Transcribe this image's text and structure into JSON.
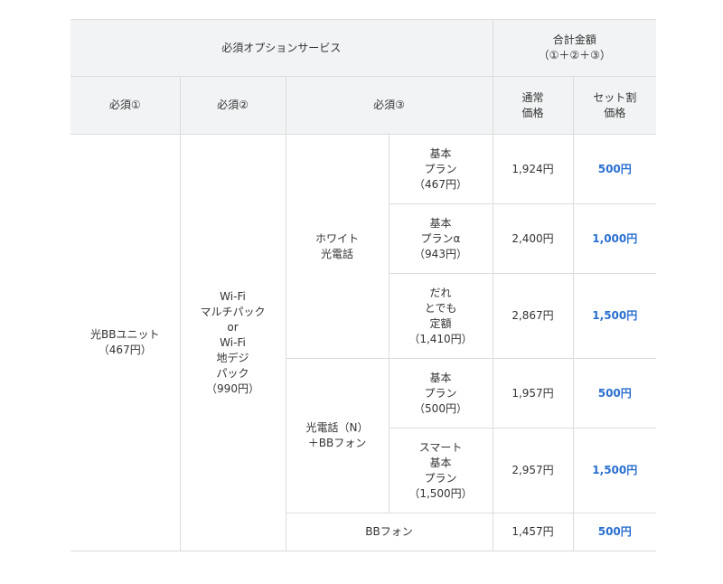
{
  "header": {
    "options_group": "必須オプションサービス",
    "total_group_line1": "合計金額",
    "total_group_line2": "（①＋②＋③）",
    "req1": "必須①",
    "req2": "必須②",
    "req3": "必須③",
    "regular_line1": "通常",
    "regular_line2": "価格",
    "set_line1": "セット割",
    "set_line2": "価格"
  },
  "unit": {
    "name": "光BBユニット",
    "price": "（467円）"
  },
  "wifi": {
    "line1": "Wi-Fi",
    "line2": "マルチパック",
    "line3": "or",
    "line4": "Wi-Fi",
    "line5": "地デジ",
    "line6": "パック",
    "line7": "（990円）"
  },
  "groups": {
    "white": {
      "line1": "ホワイト",
      "line2": "光電話"
    },
    "hikari_n": {
      "line1": "光電話（N）",
      "line2": "＋BBフォン"
    },
    "bbphone": "BBフォン"
  },
  "rows": [
    {
      "plan": [
        "基本",
        "プラン",
        "（467円）"
      ],
      "regular": "1,924円",
      "set": "500円"
    },
    {
      "plan": [
        "基本",
        "プランα",
        "（943円）"
      ],
      "regular": "2,400円",
      "set": "1,000円"
    },
    {
      "plan": [
        "だれ",
        "とでも",
        "定額",
        "（1,410円）"
      ],
      "regular": "2,867円",
      "set": "1,500円"
    },
    {
      "plan": [
        "基本",
        "プラン",
        "（500円）"
      ],
      "regular": "1,957円",
      "set": "500円"
    },
    {
      "plan": [
        "スマート",
        "基本",
        "プラン",
        "（1,500円）"
      ],
      "regular": "2,957円",
      "set": "1,500円"
    },
    {
      "plan": [],
      "regular": "1,457円",
      "set": "500円"
    }
  ],
  "colors": {
    "header_bg": "#f2f3f4",
    "border": "#dcdcdc",
    "discount_text": "#2a6fd0",
    "body_text": "#333333"
  }
}
